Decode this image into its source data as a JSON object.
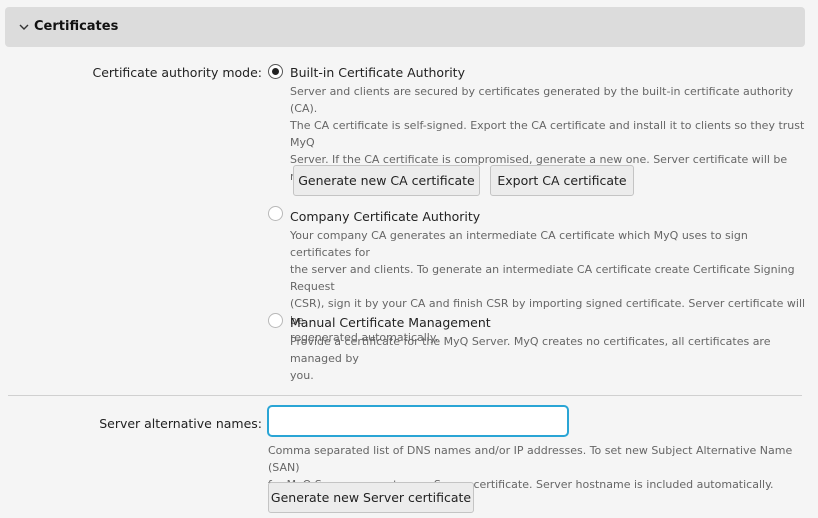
{
  "section": {
    "title": "Certificates",
    "expanded_icon": "chevron-down-icon"
  },
  "ca_mode": {
    "label": "Certificate authority mode:",
    "options": [
      {
        "title": "Built-in Certificate Authority",
        "checked": true,
        "desc": [
          "Server and clients are secured by certificates generated by the built-in certificate authority (CA).",
          "The CA certificate is self-signed. Export the CA certificate and install it to clients so they trust MyQ",
          "Server. If the CA certificate is compromised, generate a new one. Server certificate will be",
          "regenerated automatically."
        ]
      },
      {
        "title": "Company Certificate Authority",
        "checked": false,
        "desc": [
          "Your company CA generates an intermediate CA certificate which MyQ uses to sign certificates for",
          "the server and clients. To generate an intermediate CA certificate create Certificate Signing Request",
          "(CSR), sign it by your CA and finish CSR by importing signed certificate. Server certificate will be",
          "regenerated automatically."
        ]
      },
      {
        "title": "Manual Certificate Management",
        "checked": false,
        "desc": [
          "Provide a certificate for the MyQ Server. MyQ creates no certificates, all certificates are managed by",
          "you."
        ]
      }
    ],
    "buttons": {
      "generate_ca": "Generate new CA certificate",
      "export_ca": "Export CA certificate"
    }
  },
  "san": {
    "label": "Server alternative names:",
    "value": "",
    "placeholder": "",
    "help": [
      "Comma separated list of DNS names and/or IP addresses. To set new Subject Alternative Name (SAN)",
      "for MyQ Server generate new Server certificate. Server hostname is included automatically."
    ],
    "generate_button": "Generate new Server certificate"
  },
  "colors": {
    "header_bg": "#dcdcdc",
    "page_bg": "#f5f5f5",
    "focus_border": "#2aa5d5"
  }
}
